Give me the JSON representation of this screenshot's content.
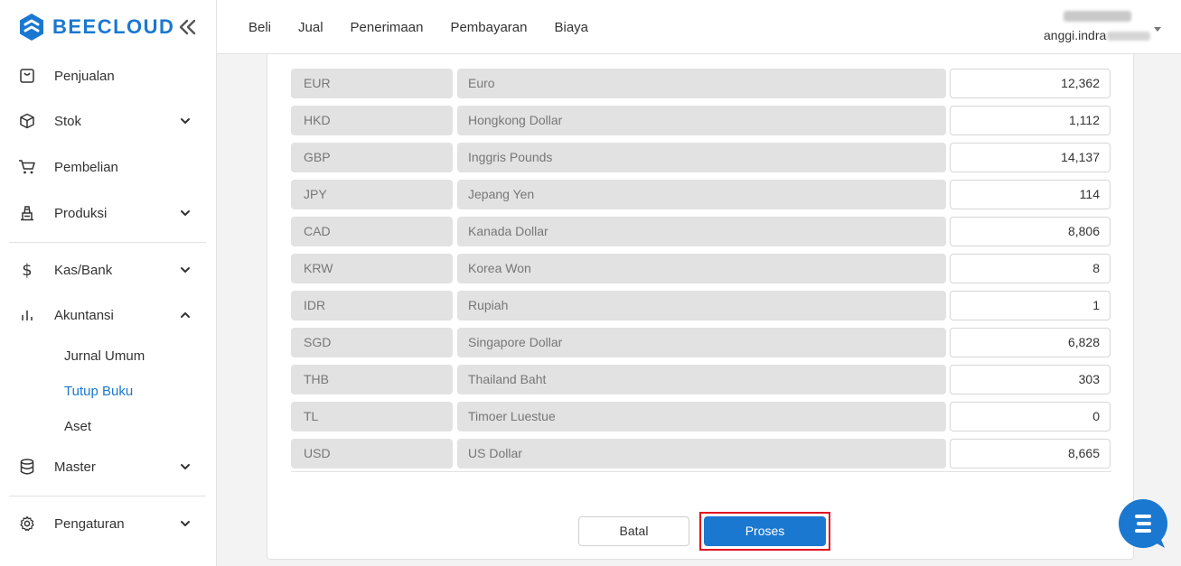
{
  "brand": {
    "name": "BEECLOUD",
    "color": "#1b78d0",
    "logo_icon": "hexagon-logo-icon",
    "collapse_icon": "double-chevron-left-icon"
  },
  "sidebar": {
    "items": [
      {
        "label": "Penjualan",
        "icon": "shopping-bag-icon",
        "expandable": false
      },
      {
        "label": "Stok",
        "icon": "box-icon",
        "expandable": true,
        "expanded": false
      },
      {
        "label": "Pembelian",
        "icon": "cart-icon",
        "expandable": false
      },
      {
        "label": "Produksi",
        "icon": "factory-icon",
        "expandable": true,
        "expanded": false
      },
      {
        "label": "Kas/Bank",
        "icon": "dollar-icon",
        "expandable": true,
        "expanded": false
      },
      {
        "label": "Akuntansi",
        "icon": "bar-chart-icon",
        "expandable": true,
        "expanded": true,
        "children": [
          {
            "label": "Jurnal Umum",
            "active": false
          },
          {
            "label": "Tutup Buku",
            "active": true
          },
          {
            "label": "Aset",
            "active": false
          }
        ]
      },
      {
        "label": "Master",
        "icon": "database-icon",
        "expandable": true,
        "expanded": false
      },
      {
        "label": "Pengaturan",
        "icon": "gear-icon",
        "expandable": true,
        "expanded": false
      }
    ]
  },
  "topnav": {
    "links": [
      "Beli",
      "Jual",
      "Penerimaan",
      "Pembayaran",
      "Biaya"
    ]
  },
  "user": {
    "email_prefix": "anggi.indra",
    "caret_icon": "caret-down-icon"
  },
  "currencies": {
    "rows": [
      {
        "code": "EUR",
        "name": "Euro",
        "rate": "12,362"
      },
      {
        "code": "HKD",
        "name": "Hongkong Dollar",
        "rate": "1,112"
      },
      {
        "code": "GBP",
        "name": "Inggris Pounds",
        "rate": "14,137"
      },
      {
        "code": "JPY",
        "name": "Jepang Yen",
        "rate": "114"
      },
      {
        "code": "CAD",
        "name": "Kanada Dollar",
        "rate": "8,806"
      },
      {
        "code": "KRW",
        "name": "Korea Won",
        "rate": "8"
      },
      {
        "code": "IDR",
        "name": "Rupiah",
        "rate": "1"
      },
      {
        "code": "SGD",
        "name": "Singapore Dollar",
        "rate": "6,828"
      },
      {
        "code": "THB",
        "name": "Thailand Baht",
        "rate": "303"
      },
      {
        "code": "TL",
        "name": "Timoer Luestue",
        "rate": "0"
      },
      {
        "code": "USD",
        "name": "US Dollar",
        "rate": "8,665"
      }
    ]
  },
  "actions": {
    "cancel_label": "Batal",
    "submit_label": "Proses",
    "highlight_color": "#e0141f"
  },
  "chat": {
    "icon": "chat-bubble-icon"
  }
}
